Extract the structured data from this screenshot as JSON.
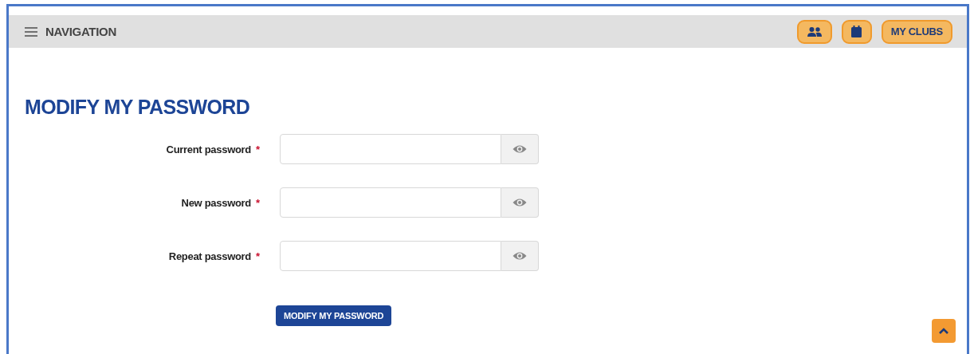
{
  "navigation": {
    "label": "NAVIGATION"
  },
  "header_buttons": [
    {
      "kind": "people"
    },
    {
      "kind": "calendar"
    },
    {
      "kind": "text",
      "label": "MY CLUBS"
    }
  ],
  "title": "MODIFY MY PASSWORD",
  "fields": [
    {
      "label": "Current password",
      "required_mark": "*"
    },
    {
      "label": "New password",
      "required_mark": "*"
    },
    {
      "label": "Repeat password",
      "required_mark": "*"
    }
  ],
  "submit": {
    "label": "MODIFY MY PASSWORD"
  },
  "scroll_top": {
    "kind": "caret-up"
  }
}
